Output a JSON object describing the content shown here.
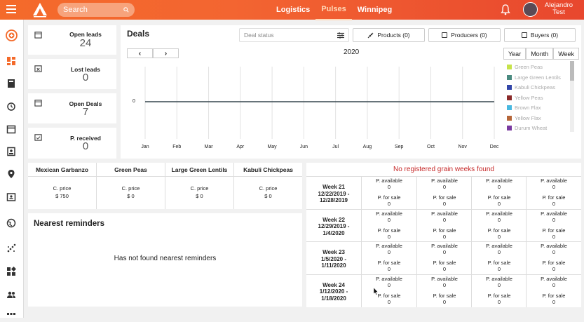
{
  "header": {
    "search_placeholder": "Search",
    "nav": [
      "Logistics",
      "Pulses",
      "Winnipeg"
    ],
    "user_name": "Alejandro",
    "user_last": "Test"
  },
  "kpis": [
    {
      "label": "Open leads",
      "value": "24"
    },
    {
      "label": "Lost leads",
      "value": "0"
    },
    {
      "label": "Open Deals",
      "value": "7"
    },
    {
      "label": "P. received",
      "value": "0"
    }
  ],
  "deals": {
    "title": "Deals",
    "status_placeholder": "Deal status",
    "products_btn": "Products (0)",
    "producers_btn": "Producers (0)",
    "buyers_btn": "Buyers (0)",
    "prev": "‹",
    "next": "›",
    "year": "2020",
    "views": [
      "Year",
      "Month",
      "Week"
    ]
  },
  "chart_data": {
    "type": "line",
    "categories": [
      "Jan",
      "Feb",
      "Mar",
      "Apr",
      "May",
      "Jun",
      "Jul",
      "Aug",
      "Sep",
      "Oct",
      "Nov",
      "Dec"
    ],
    "series": [
      {
        "values": [
          0,
          0,
          0,
          0,
          0,
          0,
          0,
          0,
          0,
          0,
          0,
          0
        ]
      }
    ],
    "y_tick": "0",
    "legend": [
      {
        "name": "Green Peas",
        "color": "#c6e34a"
      },
      {
        "name": "Large Green Lentils",
        "color": "#4a8a80"
      },
      {
        "name": "Kabuli Chickpeas",
        "color": "#3246a8"
      },
      {
        "name": "Yellow Peas",
        "color": "#8a2a2a"
      },
      {
        "name": "Brown Flax",
        "color": "#49b8e0"
      },
      {
        "name": "Yellow Flax",
        "color": "#b5663a"
      },
      {
        "name": "Durum Wheat",
        "color": "#7a3aa0"
      }
    ]
  },
  "prices": {
    "price_label": "C. price",
    "items": [
      {
        "name": "Mexican Garbanzo",
        "value": "$ 750"
      },
      {
        "name": "Green Peas",
        "value": "$ 0"
      },
      {
        "name": "Large Green Lentils",
        "value": "$ 0"
      },
      {
        "name": "Kabuli Chickpeas",
        "value": "$ 0"
      }
    ]
  },
  "reminders": {
    "title": "Nearest reminders",
    "empty": "Has not found nearest reminders"
  },
  "grain": {
    "not_found": "No registered grain weeks found",
    "available_label": "P. available",
    "sale_label": "P. for sale",
    "weeks": [
      {
        "week": "Week 21",
        "dates": "12/22/2019 -",
        "dates2": "12/28/2019"
      },
      {
        "week": "Week 22",
        "dates": "12/29/2019 -",
        "dates2": "1/4/2020"
      },
      {
        "week": "Week 23",
        "dates": "1/5/2020 -",
        "dates2": "1/11/2020"
      },
      {
        "week": "Week 24",
        "dates": "1/12/2020 -",
        "dates2": "1/18/2020"
      }
    ],
    "cell_value": "0"
  }
}
